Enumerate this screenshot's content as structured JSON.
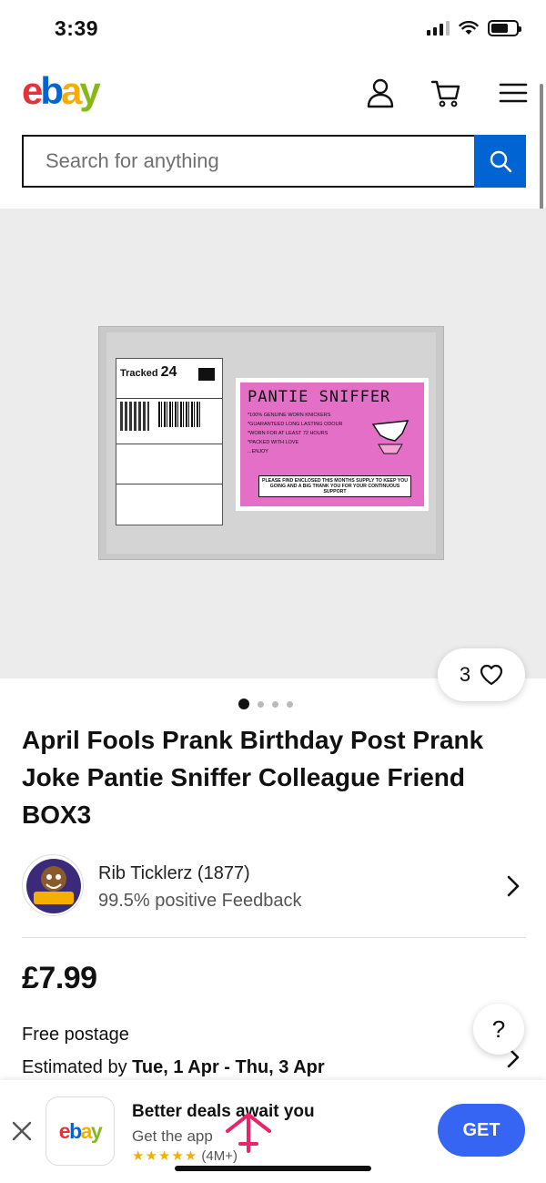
{
  "status": {
    "time": "3:39"
  },
  "header": {
    "logo": {
      "e": "e",
      "b": "b",
      "a": "a",
      "y": "y"
    },
    "icons": [
      "account-icon",
      "cart-icon",
      "menu-icon"
    ]
  },
  "search": {
    "placeholder": "Search for anything",
    "value": ""
  },
  "hero": {
    "image_pagination": {
      "current": 1,
      "total": 4
    },
    "likes": "3",
    "label": {
      "tracked": "Tracked",
      "tracked_num": "24",
      "pink_title": "PANTIE SNIFFER",
      "lines": [
        "*100% GENUINE WORN KNICKERS",
        "*GUARANTEED LONG LASTING ODOUR",
        "*WORN FOR AT LEAST 72 HOURS",
        "*PACKED WITH LOVE",
        "...ENJOY"
      ],
      "footer": "PLEASE FIND ENCLOSED THIS MONTHS SUPPLY TO KEEP YOU GOING AND A BIG THANK YOU FOR YOUR CONTINUOUS SUPPORT"
    }
  },
  "listing": {
    "title": "April Fools Prank Birthday Post Prank Joke Pantie Sniffer Colleague Friend BOX3",
    "price": "£7.99",
    "postage": "Free postage",
    "estimate_prefix": "Estimated by ",
    "estimate_dates": "Tue, 1 Apr - Thu, 3 Apr"
  },
  "seller": {
    "name": "Rib Ticklerz (1877)",
    "feedback": "99.5% positive Feedback",
    "avatar_text": "RIB TICKLERZ"
  },
  "help": {
    "label": "?"
  },
  "app_banner": {
    "logo": "ebay",
    "title": "Better deals await you",
    "subtitle": "Get the app",
    "stars": "★★★★★",
    "rating_count": "(4M+)",
    "button": "GET"
  },
  "colors": {
    "brand_blue": "#0064d2",
    "get_button": "#3665f3",
    "logo_red": "#e53238",
    "logo_yellow": "#f5af02",
    "logo_green": "#86b817",
    "pink_label": "#e46fc7"
  }
}
